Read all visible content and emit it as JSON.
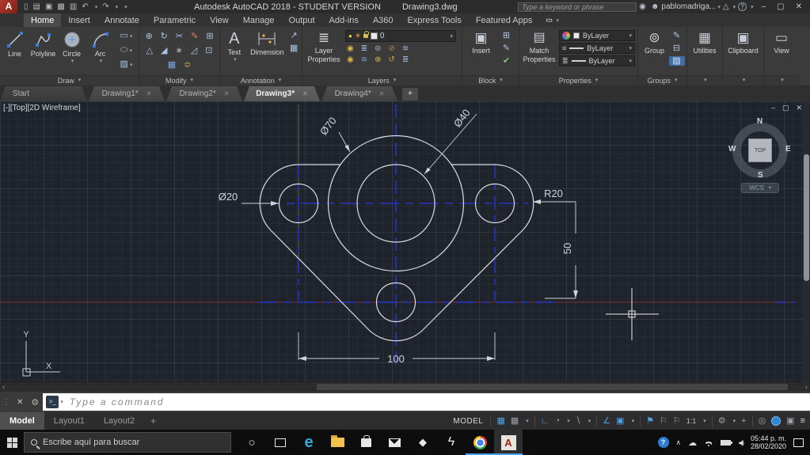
{
  "colors": {
    "accent_blue": "#4aa3e8",
    "centerline_blue": "#2836e6",
    "axis_red": "#7e2a2a",
    "axis_green": "#3c7a3c",
    "geometry_white": "#d9dce1",
    "canvas_bg": "#1f242c"
  },
  "titlebar": {
    "title": "Autodesk AutoCAD 2018 - STUDENT VERSION",
    "doc": "Drawing3.dwg",
    "search_placeholder": "Type a keyword or phrase",
    "user": "pablomadriga..."
  },
  "icons": {
    "app_logo": "A",
    "caret": "▾",
    "qat": [
      "▯",
      "▤",
      "▣",
      "▩",
      "▥",
      "↶",
      "↷"
    ],
    "binoculars": "◉",
    "user": "☻",
    "a360": "△",
    "help": "?",
    "win_min": "–",
    "win_restore": "▢",
    "win_close": "✕",
    "ribbon_toggle": "▭",
    "tab_close": "✕",
    "modify": [
      "⊕",
      "↻",
      "✂",
      "✎",
      "⊞",
      "△",
      "◢",
      "∗",
      "◿",
      "⊡",
      "▦",
      "≎"
    ],
    "annot_side": [
      "↗",
      "▦"
    ],
    "text_icon": "A",
    "layers_big": "≣",
    "bulb": "●",
    "sun": "☀",
    "layer_tools_1": [
      "◉",
      "≣",
      "⊜",
      "⊘",
      "≋"
    ],
    "layer_tools_2": [
      "◉",
      "≋",
      "⊕",
      "↺",
      "≣"
    ],
    "insert_big": "▣",
    "block_side": [
      "⊞",
      "✎",
      "✔"
    ],
    "match_icon": "▤",
    "prop_row_icons": [
      "≡",
      "≣"
    ],
    "group_big": "⊚",
    "group_side": [
      "✎",
      "⊟",
      "▨"
    ],
    "utilities_icon": "▦",
    "clipboard_icon": "▣",
    "view_icon": "▭",
    "scroll_left": "‹",
    "scroll_right": "›",
    "cmd_grip": "⋮",
    "cmd_close": "✕",
    "cmd_wrench": "⚙",
    "cmd_prompt": "&gt;_",
    "status": {
      "grid": "▦",
      "snap": "▦",
      "ortho": "∟",
      "polar": "◔",
      "iso": "∖",
      "otrack": "∠",
      "osnap": "▣",
      "annot1": "⚑",
      "annot2": "⚐",
      "annot3": "⚐",
      "gear": "⚙",
      "plus": "+",
      "isolate": "◎",
      "fullscreen": "▣",
      "menu": "≡"
    },
    "cortana": "○",
    "edge": "e",
    "dropbox": "◆",
    "bolt": "ϟ",
    "tray_chevron": "∧",
    "tray_cloud": "☁",
    "tray_speaker": "◀)"
  },
  "ribbon": {
    "tabs": [
      "Home",
      "Insert",
      "Annotate",
      "Parametric",
      "View",
      "Manage",
      "Output",
      "Add-ins",
      "A360",
      "Express Tools",
      "Featured Apps"
    ],
    "active_tab": "Home",
    "panels": {
      "draw": {
        "label": "Draw",
        "line": "Line",
        "polyline": "Polyline",
        "circle": "Circle",
        "arc": "Arc"
      },
      "modify": {
        "label": "Modify"
      },
      "annotation": {
        "label": "Annotation",
        "text": "Text",
        "dimension": "Dimension"
      },
      "layers": {
        "label": "Layers",
        "btn_line1": "Layer",
        "btn_line2": "Properties",
        "current_layer": "0"
      },
      "block": {
        "label": "Block",
        "insert": "Insert"
      },
      "properties": {
        "label": "Properties",
        "match_line1": "Match",
        "match_line2": "Properties",
        "color": "ByLayer",
        "lineweight": "ByLayer",
        "linetype": "ByLayer"
      },
      "groups": {
        "label": "Groups",
        "group": "Group"
      },
      "utilities": {
        "label": "Utilities"
      },
      "clipboard": {
        "label": "Clipboard"
      },
      "view": {
        "label": "View"
      }
    }
  },
  "file_tabs": {
    "tabs": [
      "Start",
      "Drawing1*",
      "Drawing2*",
      "Drawing3*",
      "Drawing4*"
    ],
    "active": "Drawing3*",
    "add": "+"
  },
  "viewport": {
    "controls": "[-][Top][2D Wireframe]",
    "viewcube": {
      "n": "N",
      "e": "E",
      "s": "S",
      "w": "W",
      "top": "TOP",
      "wcs": "WCS"
    }
  },
  "drawing": {
    "dim_d70": "Ø70",
    "dim_d40": "Ø40",
    "dim_d20": "Ø20",
    "dim_r20": "R20",
    "dim_50": "50",
    "dim_100": "100",
    "axis_x": "X",
    "axis_y": "Y"
  },
  "command": {
    "placeholder": "Type a command"
  },
  "layout_tabs": {
    "model": "Model",
    "layout1": "Layout1",
    "layout2": "Layout2",
    "add": "+"
  },
  "status": {
    "model": "MODEL",
    "scale": "1:1"
  },
  "taskbar": {
    "search_placeholder": "Escribe aquí para buscar",
    "time": "05:44 p. m.",
    "date": "28/02/2020"
  }
}
